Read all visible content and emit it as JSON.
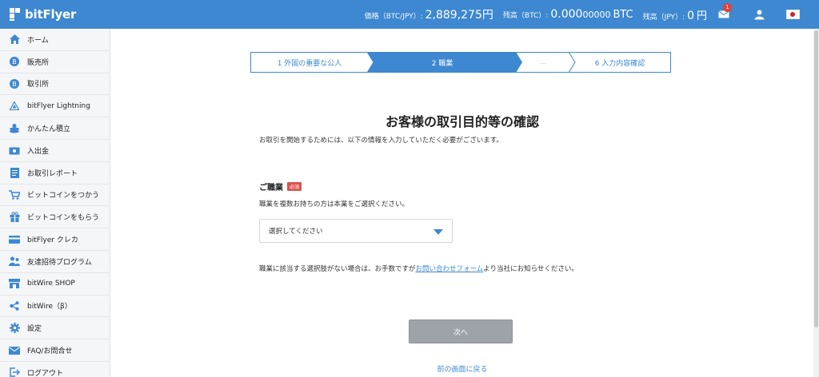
{
  "header": {
    "logo_text": "bitFlyer",
    "price_label": "価格（BTC/JPY）:",
    "price_value": "2,889,275",
    "price_unit": "円",
    "btc_balance_label": "残高（BTC）:",
    "btc_balance_main": "0.000",
    "btc_balance_dim": "00000",
    "btc_balance_unit": "BTC",
    "jpy_balance_label": "残高（JPY）:",
    "jpy_balance_value": "0",
    "jpy_balance_unit": "円",
    "mail_badge": "1",
    "icons": [
      "mail-icon",
      "user-icon",
      "japan-flag-icon"
    ]
  },
  "sidebar": {
    "items": [
      {
        "label": "ホーム",
        "icon": "home-icon"
      },
      {
        "label": "販売所",
        "icon": "bitcoin-coin-icon"
      },
      {
        "label": "取引所",
        "icon": "bitcoin-coin-icon"
      },
      {
        "label": "bitFlyer Lightning",
        "icon": "lightning-triangle-icon"
      },
      {
        "label": "かんたん積立",
        "icon": "coin-stack-icon"
      },
      {
        "label": "入出金",
        "icon": "wallet-icon"
      },
      {
        "label": "お取引レポート",
        "icon": "report-icon"
      },
      {
        "label": "ビットコインをつかう",
        "icon": "cart-icon"
      },
      {
        "label": "ビットコインをもらう",
        "icon": "gift-icon"
      },
      {
        "label": "bitFlyer クレカ",
        "icon": "credit-card-icon"
      },
      {
        "label": "友達招待プログラム",
        "icon": "friends-icon"
      },
      {
        "label": "bitWire SHOP",
        "icon": "shop-icon"
      },
      {
        "label": "bitWire（β）",
        "icon": "share-icon"
      },
      {
        "label": "設定",
        "icon": "gear-icon"
      },
      {
        "label": "FAQ/お問合せ",
        "icon": "mail-icon"
      },
      {
        "label": "ログアウト",
        "icon": "logout-icon"
      }
    ]
  },
  "stepper": {
    "steps": [
      {
        "label": "1 外国の重要な公人",
        "active": false
      },
      {
        "label": "2 職業",
        "active": true
      },
      {
        "label": "…",
        "active": false
      },
      {
        "label": "6 入力内容確認",
        "active": false
      }
    ]
  },
  "main": {
    "title": "お客様の取引目的等の確認",
    "description": "お取引を開始するためには、以下の情報を入力していただく必要がございます。",
    "field_label": "ご職業",
    "required_badge": "必須",
    "field_help": "職業を複数お持ちの方は本業をご選択ください。",
    "select_placeholder": "選択してください",
    "note_before": "職業に該当する選択肢がない場合は、お手数ですが",
    "note_link": "お問い合わせフォーム",
    "note_after": "より当社にお知らせください。",
    "next_button": "次へ",
    "back_link": "前の画面に戻る"
  },
  "colors": {
    "brand": "#3d88d0",
    "required": "#d9534f",
    "disabled_button": "#9da3a9"
  }
}
